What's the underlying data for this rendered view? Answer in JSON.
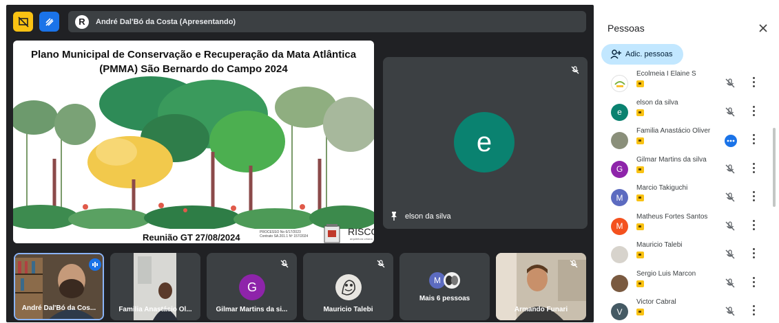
{
  "topbar": {
    "presenter_initial": "R",
    "presenting_text": "André Dal'Bó da Costa (Apresentando)"
  },
  "slide": {
    "title_line1": "Plano Municipal de Conservação e Recuperação da Mata Atlântica",
    "title_line2": "(PMMA) São Bernardo do Campo 2024",
    "footer": "Reunião GT 27/08/2024",
    "process_line1": "PROCESSO No 6/17/2023",
    "process_line2": "Contrato SA.201.1 Nº 157/2024",
    "brand": "RISCO",
    "brand_sub": "arquitetura urbana"
  },
  "main_tile": {
    "initial": "e",
    "name": "elson da silva"
  },
  "tiles": [
    {
      "name": "André Dal'Bó da Cos..."
    },
    {
      "name": "Familia Anastácio Ol..."
    },
    {
      "name": "Gilmar Martins da si...",
      "initial": "G"
    },
    {
      "name": "Mauricio Talebi"
    },
    {
      "name": "Mais 6 pessoas",
      "initial": "M"
    },
    {
      "name": "Armando Funari"
    }
  ],
  "panel": {
    "title": "Pessoas",
    "add_label": "Adic. pessoas",
    "people": [
      {
        "name": "Ecolmeia I Elaine S",
        "initial": "",
        "color": "#ffffff"
      },
      {
        "name": "elson da silva",
        "initial": "e",
        "color": "#0a8270"
      },
      {
        "name": "Familia Anastácio Oliver",
        "initial": "",
        "color": "#8a8f7a"
      },
      {
        "name": "Gilmar Martins da silva",
        "initial": "G",
        "color": "#8e24aa"
      },
      {
        "name": "Marcio Takiguchi",
        "initial": "M",
        "color": "#5c6bc0"
      },
      {
        "name": "Matheus Fortes Santos",
        "initial": "M",
        "color": "#f4511e"
      },
      {
        "name": "Mauricio Talebi",
        "initial": "",
        "color": "#d7d3cc"
      },
      {
        "name": "Sergio Luis Marcon",
        "initial": "",
        "color": "#7a5a40"
      },
      {
        "name": "Victor Cabral",
        "initial": "V",
        "color": "#455a64"
      }
    ]
  },
  "colors": {
    "accent_yellow": "#f9c213",
    "accent_blue": "#1a73e8",
    "stage_bg": "#202124",
    "tile_bg": "#3c4043"
  }
}
